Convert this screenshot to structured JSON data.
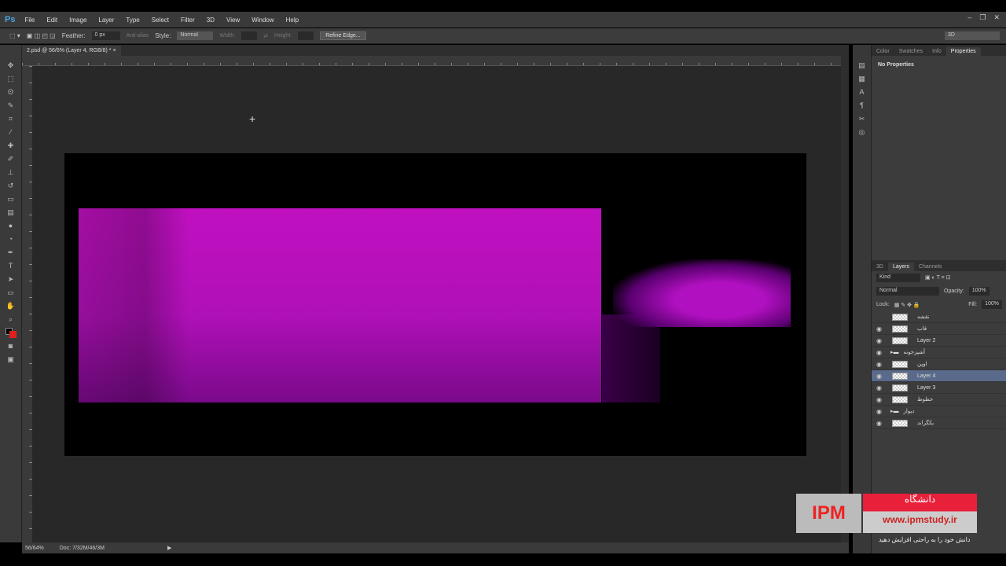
{
  "app": {
    "logo": "Ps"
  },
  "menu": [
    "File",
    "Edit",
    "Image",
    "Layer",
    "Type",
    "Select",
    "Filter",
    "3D",
    "View",
    "Window",
    "Help"
  ],
  "window_controls": [
    "–",
    "❐",
    "✕"
  ],
  "options": {
    "feather_label": "Feather:",
    "feather_value": "0 px",
    "antialias": "Anti-alias",
    "style_label": "Style:",
    "style_value": "Normal",
    "width_label": "Width:",
    "height_label": "Height:",
    "refine": "Refine Edge...",
    "workspace": "3D"
  },
  "document": {
    "tab": "2.psd @ 56/6% (Layer 4, RGB/8) *",
    "close": "×"
  },
  "status": {
    "zoom": "56/64%",
    "doc": "Doc: 7/32M/46/3M"
  },
  "props_tabs": [
    "Color",
    "Swatches",
    "Info",
    "Properties"
  ],
  "props_text": "No Properties",
  "layers_tabs": [
    "3D",
    "Layers",
    "Channels"
  ],
  "layers": {
    "kind": "Kind",
    "blend": "Normal",
    "opacity_label": "Opacity:",
    "opacity": "100%",
    "lock_label": "Lock:",
    "fill_label": "Fill:",
    "fill": "100%",
    "items": [
      {
        "name": "نقشه",
        "visible": false
      },
      {
        "name": "قاب",
        "visible": true
      },
      {
        "name": "Layer 2",
        "visible": true
      },
      {
        "name": "آشپزخونه",
        "visible": true,
        "group": true
      },
      {
        "name": "اوپن",
        "visible": true
      },
      {
        "name": "Layer 4",
        "visible": true,
        "selected": true
      },
      {
        "name": "Layer 3",
        "visible": true
      },
      {
        "name": "خطوط",
        "visible": true
      },
      {
        "name": "دیوار",
        "visible": true,
        "group": true
      },
      {
        "name": "بکگراند",
        "visible": true
      }
    ]
  },
  "watermark": {
    "logo": "IPM",
    "title": "دانشگاه",
    "url": "www.ipmstudy.ir",
    "tagline": "دانش خود را به راحتی افزایش دهید"
  },
  "colors": {
    "magenta": "#c010c0",
    "workspace": "#282828"
  }
}
